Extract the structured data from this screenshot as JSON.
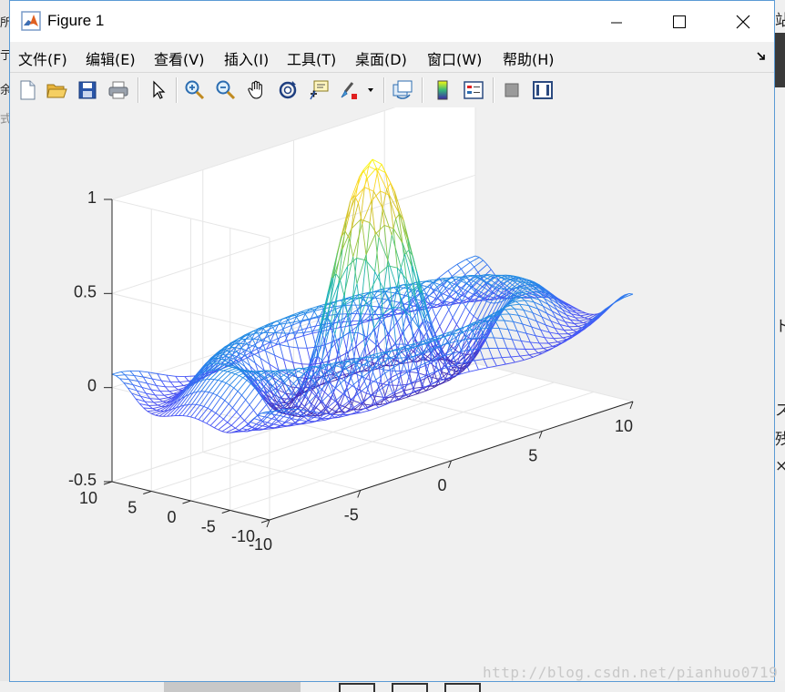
{
  "window": {
    "title": "Figure 1",
    "controls": {
      "minimize": "—",
      "maximize": "☐",
      "close": "✕"
    }
  },
  "menu": {
    "items": [
      "文件(F)",
      "编辑(E)",
      "查看(V)",
      "插入(I)",
      "工具(T)",
      "桌面(D)",
      "窗口(W)",
      "帮助(H)"
    ]
  },
  "toolbar": {
    "buttons": [
      "new-figure",
      "open-file",
      "save",
      "print",
      "edit-plot",
      "zoom-in",
      "zoom-out",
      "pan",
      "rotate-3d",
      "data-cursor",
      "brush",
      "link-plot",
      "colorbar",
      "legend",
      "hide-plot-tools",
      "show-plot-tools"
    ]
  },
  "background": {
    "left_fragments": [
      "所",
      "亍",
      "余",
      "式"
    ],
    "right_fragments": [
      "站",
      "ト",
      "ス",
      "残",
      "×"
    ]
  },
  "watermark": "http://blog.csdn.net/pianhuo0719",
  "chart_data": {
    "type": "mesh",
    "function": "z = sin(sqrt(x^2+y^2)) / sqrt(x^2+y^2)",
    "x": {
      "range": [
        -10,
        10
      ],
      "ticks": [
        "-10",
        "-5",
        "0",
        "5",
        "10"
      ]
    },
    "y": {
      "range": [
        -10,
        10
      ],
      "ticks": [
        "-10",
        "-5",
        "0",
        "5",
        "10"
      ]
    },
    "z": {
      "range": [
        -0.5,
        1
      ],
      "ticks": [
        "-0.5",
        "0",
        "0.5",
        "1"
      ]
    },
    "grid_step": 0.5,
    "peak": {
      "x": 0,
      "y": 0,
      "z": 1
    },
    "colormap": "parula",
    "grid": true,
    "title": "",
    "xlabel": "",
    "ylabel": "",
    "zlabel": ""
  }
}
